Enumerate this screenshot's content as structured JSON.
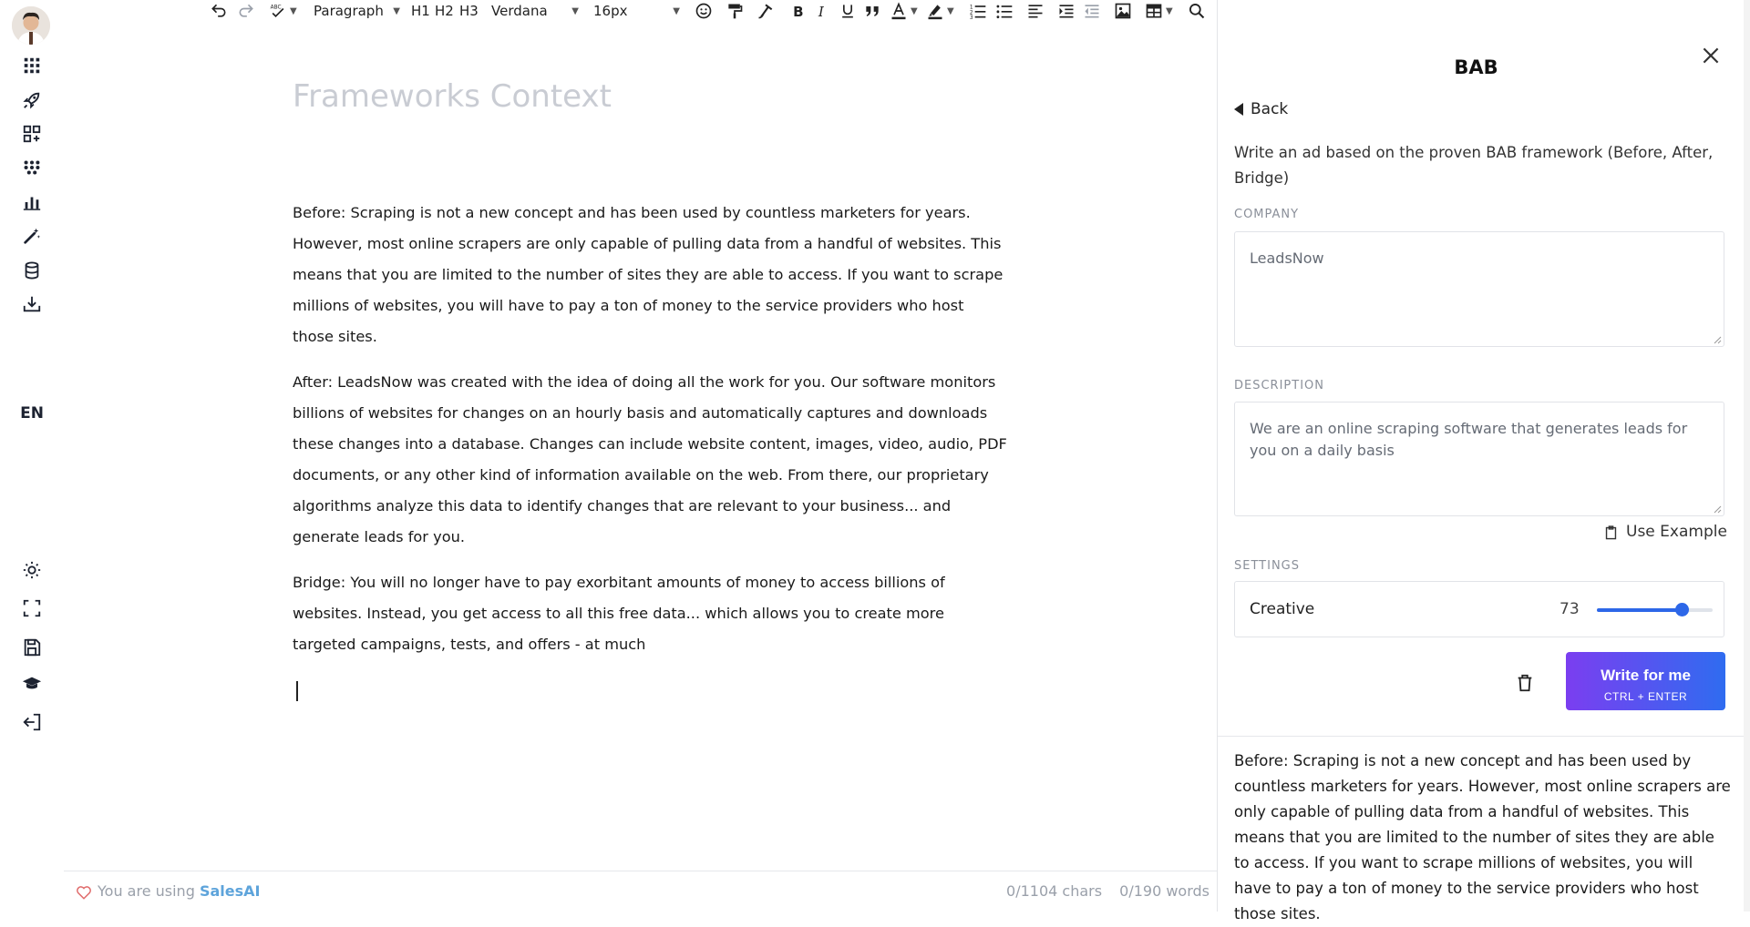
{
  "rail": {
    "language": "EN",
    "icons": [
      "grid-apps-icon",
      "rocket-icon",
      "add-widget-icon",
      "dots-grid-icon",
      "bar-chart-icon",
      "magic-wand-icon",
      "database-icon",
      "download-icon",
      "sun-icon",
      "fullscreen-icon",
      "save-icon",
      "graduation-cap-icon",
      "logout-icon"
    ]
  },
  "toolbar": {
    "block_format": "Paragraph",
    "h1": "H1",
    "h2": "H2",
    "h3": "H3",
    "font_family": "Verdana",
    "font_size": "16px"
  },
  "editor": {
    "title_placeholder": "Frameworks Context",
    "paragraphs": [
      "Before: Scraping is not a new concept and has been used by countless marketers for years. However, most online scrapers are only capable of pulling data from a handful of websites. This means that you are limited to the number of sites they are able to access. If you want to scrape millions of websites, you will have to pay a ton of money to the service providers who host those sites.",
      "After: LeadsNow was created with the idea of doing all the work for you. Our software monitors billions of websites for changes on an hourly basis and automatically captures and downloads these changes into a database. Changes can include website content, images, video, audio, PDF documents, or any other kind of information available on the web. From there, our proprietary algorithms analyze this data to identify changes that are relevant to your business... and generate leads for you.",
      "Bridge: You will no longer have to pay exorbitant amounts of money to access billions of websites. Instead, you get access to all this free data... which allows you to create more targeted campaigns, tests, and offers - at much"
    ]
  },
  "footer": {
    "using_prefix": "You are using",
    "brand": "SalesAI",
    "chars": "0/1104 chars",
    "words": "0/190 words"
  },
  "panel": {
    "title": "BAB",
    "back": "Back",
    "description": "Write an ad based on the proven BAB framework (Before, After, Bridge)",
    "company_label": "COMPANY",
    "company_value": "LeadsNow",
    "description_label": "DESCRIPTION",
    "description_value": "We are an online scraping software that generates leads for you on a daily basis",
    "use_example": "Use Example",
    "settings_label": "SETTINGS",
    "creative_label": "Creative",
    "creative_value": "73",
    "creative_fraction": 0.73,
    "write_label": "Write for me",
    "write_shortcut": "CTRL + ENTER",
    "result_text": "Before: Scraping is not a new concept and has been used by countless marketers for years. However, most online scrapers are only capable of pulling data from a handful of websites. This means that you are limited to the number of sites they are able to access. If you want to scrape millions of websites, you will have to pay a ton of money to the service providers who host those sites."
  },
  "colors": {
    "accent": "#2d67e8",
    "button_gradient_start": "#7b3ef0",
    "button_gradient_end": "#2f6cf0",
    "brand_link": "#5ea4db"
  }
}
